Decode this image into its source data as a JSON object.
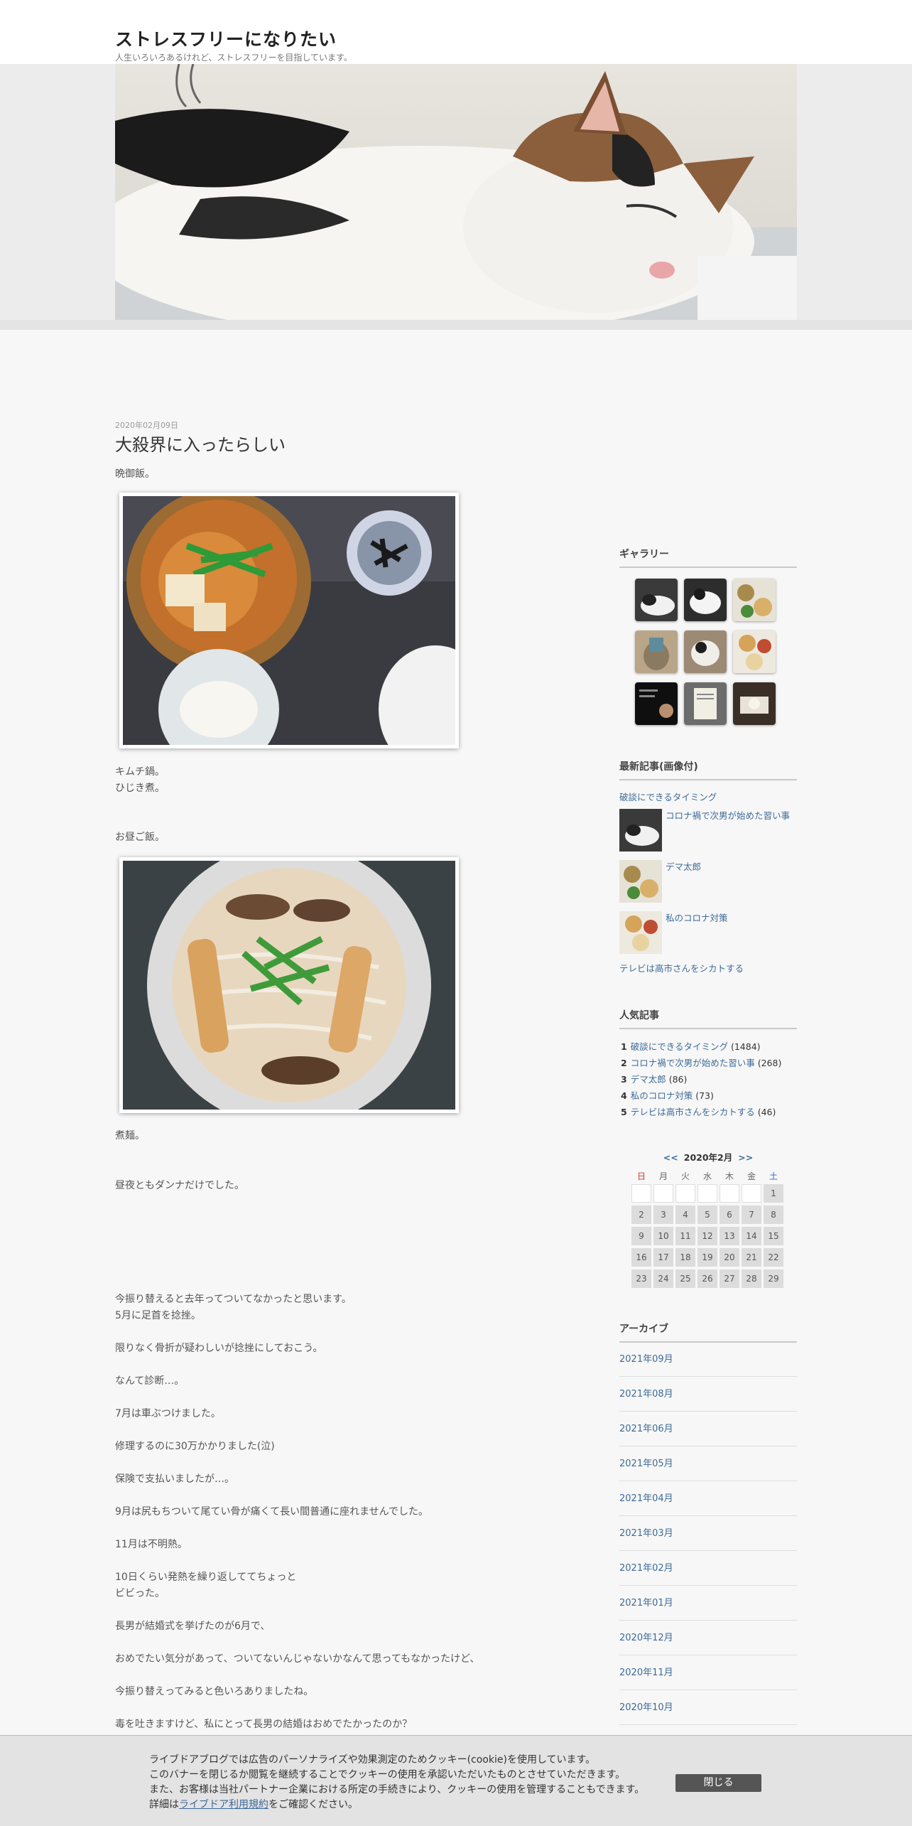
{
  "blog": {
    "title": "ストレスフリーになりたい",
    "description": "人生いろいろあるけれど、ストレスフリーを目指しています。"
  },
  "post": {
    "date": "2020年02月09日",
    "title": "大殺界に入ったらしい",
    "paragraphs": [
      "晩御飯。",
      "キムチ鍋。",
      "ひじき煮。",
      "お昼ご飯。",
      "煮麺。",
      "昼夜ともダンナだけでした。",
      "今振り替えると去年ってついてなかったと思います。",
      "5月に足首を捻挫。",
      "限りなく骨折が疑わしいが捻挫にしておこう。",
      "なんて診断…。",
      "7月は車ぶつけました。",
      "修理するのに30万かかりました(泣)",
      "保険で支払いましたが…。",
      "9月は尻もちついて尾てい骨が痛くて長い間普通に座れませんでした。",
      "11月は不明熱。",
      "10日くらい発熱を繰り返しててちょっと",
      "ビビった。",
      "長男が結婚式を挙げたのが6月で、",
      "おめでたい気分があって、ついてないんじゃないかなんて思ってもなかったけど、",
      "今振り替えってみると色いろありましたね。",
      "毒を吐きますけど、私にとって長男の結婚はおめでたかったのか？"
    ]
  },
  "sidebar": {
    "gallery_title": "ギャラリー",
    "recent_title": "最新記事(画像付)",
    "recent": [
      "破談にできるタイミング",
      "コロナ禍で次男が始めた習い事",
      "デマ太郎",
      "私のコロナ対策",
      "テレビは高市さんをシカトする"
    ],
    "popular_title": "人気記事",
    "popular": [
      {
        "rank": "1",
        "title": "破談にできるタイミング",
        "count": "(1484)"
      },
      {
        "rank": "2",
        "title": "コロナ禍で次男が始めた習い事",
        "count": "(268)"
      },
      {
        "rank": "3",
        "title": "デマ太郎",
        "count": "(86)"
      },
      {
        "rank": "4",
        "title": "私のコロナ対策",
        "count": "(73)"
      },
      {
        "rank": "5",
        "title": "テレビは高市さんをシカトする",
        "count": "(46)"
      }
    ],
    "calendar": {
      "prev": "<<",
      "month": "2020年2月",
      "next": ">>",
      "weekdays": [
        "日",
        "月",
        "火",
        "水",
        "木",
        "金",
        "土"
      ],
      "days": [
        "1",
        "2",
        "3",
        "4",
        "5",
        "6",
        "7",
        "8",
        "9",
        "10",
        "11",
        "12",
        "13",
        "14",
        "15",
        "16",
        "17",
        "18",
        "19",
        "20",
        "21",
        "22",
        "23",
        "24",
        "25",
        "26",
        "27",
        "28",
        "29"
      ]
    },
    "archive_title": "アーカイブ",
    "archives": [
      "2021年09月",
      "2021年08月",
      "2021年06月",
      "2021年05月",
      "2021年04月",
      "2021年03月",
      "2021年02月",
      "2021年01月",
      "2020年12月",
      "2020年11月",
      "2020年10月"
    ]
  },
  "cookie": {
    "line1": "ライブドアブログでは広告のパーソナライズや効果測定のためクッキー(cookie)を使用しています。",
    "line2": "このバナーを閉じるか閲覧を継続することでクッキーの使用を承認いただいたものとさせていただきます。",
    "line3": "また、お客様は当社パートナー企業における所定の手続きにより、クッキーの使用を管理することもできます。",
    "line4_prefix": "詳細は",
    "line4_link": "ライブドア利用規約",
    "line4_suffix": "をご確認ください。",
    "close_label": "閉じる"
  },
  "colors": {
    "link": "#3d6a98",
    "sunday": "#cc3333",
    "saturday": "#3366cc"
  }
}
